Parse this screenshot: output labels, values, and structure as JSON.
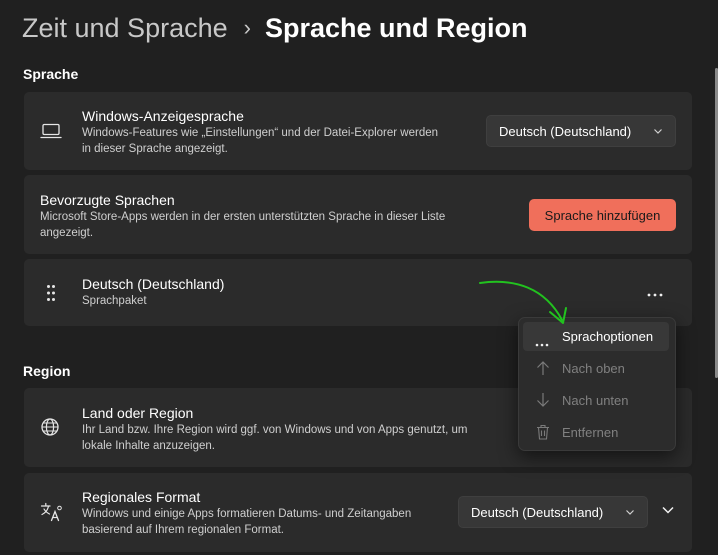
{
  "breadcrumb": {
    "parent": "Zeit und Sprache",
    "separator": "›",
    "current": "Sprache und Region"
  },
  "sections": {
    "language": "Sprache",
    "region": "Region"
  },
  "display_language": {
    "title": "Windows-Anzeigesprache",
    "desc_line1": "Windows-Features wie „Einstellungen“ und der Datei-Explorer werden",
    "desc_line2": "in dieser Sprache angezeigt.",
    "selected": "Deutsch (Deutschland)",
    "icon": "laptop-icon"
  },
  "preferred_languages": {
    "title": "Bevorzugte Sprachen",
    "desc_line1": "Microsoft Store-Apps werden in der ersten unterstützten Sprache in dieser Liste",
    "desc_line2": "angezeigt.",
    "add_button": "Sprache hinzufügen"
  },
  "language_item": {
    "name": "Deutsch (Deutschland)",
    "sub": "Sprachpaket",
    "more": "..."
  },
  "context_menu": {
    "items": [
      {
        "label": "Sprachoptionen",
        "state": "active",
        "icon": "more-icon"
      },
      {
        "label": "Nach oben",
        "state": "disabled",
        "icon": "arrow-up-icon"
      },
      {
        "label": "Nach unten",
        "state": "disabled",
        "icon": "arrow-down-icon"
      },
      {
        "label": "Entfernen",
        "state": "disabled",
        "icon": "trash-icon"
      }
    ]
  },
  "country": {
    "title": "Land oder Region",
    "desc_line1": "Ihr Land bzw. Ihre Region wird ggf. von Windows und von Apps genutzt, um",
    "desc_line2": "lokale Inhalte anzuzeigen.",
    "icon": "globe-icon"
  },
  "regional_format": {
    "title": "Regionales Format",
    "desc_line1": "Windows und einige Apps formatieren Datums- und Zeitangaben",
    "desc_line2": "basierend auf Ihrem regionalen Format.",
    "selected": "Deutsch (Deutschland)",
    "icon": "regional-format-icon"
  },
  "colors": {
    "background": "#202020",
    "card": "#2b2b2b",
    "accent": "#f06f5b",
    "annotation": "#22c21f"
  }
}
